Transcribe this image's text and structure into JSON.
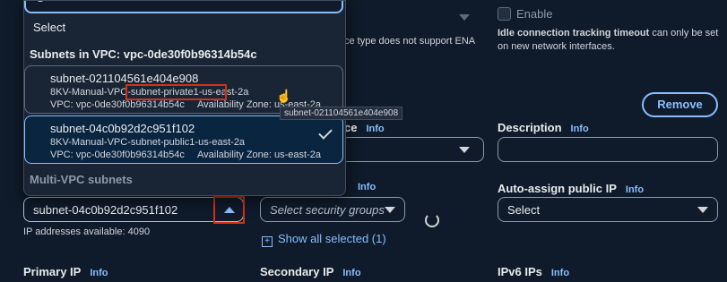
{
  "dropdown": {
    "select_label": "Select",
    "group_vpc": "Subnets in VPC: vpc-0de30f0b96314b54c",
    "group_multi": "Multi-VPC subnets",
    "options": [
      {
        "id": "subnet-021104561e404e908",
        "name": "8KV-Manual-VPC-subnet-private1-us-east-2a",
        "vpc": "VPC: vpc-0de30f0b96314b54c",
        "az": "Availability Zone: us-east-2a"
      },
      {
        "id": "subnet-04c0b92d2c951f102",
        "name": "8KV-Manual-VPC-subnet-public1-us-east-2a",
        "vpc": "VPC: vpc-0de30f0b96314b54c",
        "az": "Availability Zone: us-east-2a"
      }
    ],
    "tooltip": "subnet-021104561e404e908"
  },
  "ena": {
    "enable_label": "Enable",
    "note": "ce type does not support ENA"
  },
  "idle": {
    "title": "Idle connection tracking timeout",
    "rest": " can only be set",
    "line2": "on new network interfaces."
  },
  "remove_button": "Remove",
  "description": {
    "label": "Description",
    "info": "Info"
  },
  "security_info": {
    "label_tail": "ce",
    "info": "Info"
  },
  "subnet_info": "Info",
  "auto_assign": {
    "label": "Auto-assign public IP",
    "info": "Info",
    "value": "Select"
  },
  "subnet_field": {
    "value": "subnet-04c0b92d2c951f102",
    "ip_available": "IP addresses available: 4090"
  },
  "security_groups": {
    "placeholder": "Select security groups"
  },
  "show_all": "Show all selected (1)",
  "primary_ip": {
    "label": "Primary IP",
    "info": "Info"
  },
  "secondary_ip": {
    "label": "Secondary IP",
    "info": "Info"
  },
  "ipv6": {
    "label": "IPv6 IPs",
    "info": "Info"
  },
  "colors": {
    "accent": "#89bdff",
    "highlight": "#d13212",
    "background": "#0f1b2a"
  }
}
